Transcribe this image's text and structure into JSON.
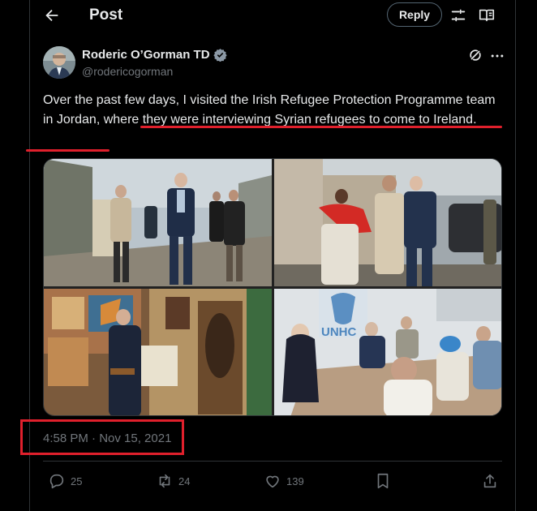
{
  "header": {
    "title": "Post",
    "reply_label": "Reply"
  },
  "author": {
    "name": "Roderic O’Gorman TD",
    "handle": "@rodericogorman",
    "verified": true
  },
  "tweet": {
    "text_part1": "Over the past few days, I visited the Irish Refugee Protection Programme team in Jordan, ",
    "text_part2": "where they were interviewing Syrian refugees to come to Ireland",
    "text_part3": "."
  },
  "media": {
    "photo_count": 4,
    "signs": [
      "UNHCR",
      "UNHC"
    ]
  },
  "timestamp": "4:58 PM · Nov 15, 2021",
  "actions": {
    "replies": "25",
    "reposts": "24",
    "likes": "139"
  },
  "colors": {
    "accent_red": "#e0202c",
    "muted": "#71767b",
    "border": "#2f3336",
    "verified_badge": "#8b98a5"
  }
}
